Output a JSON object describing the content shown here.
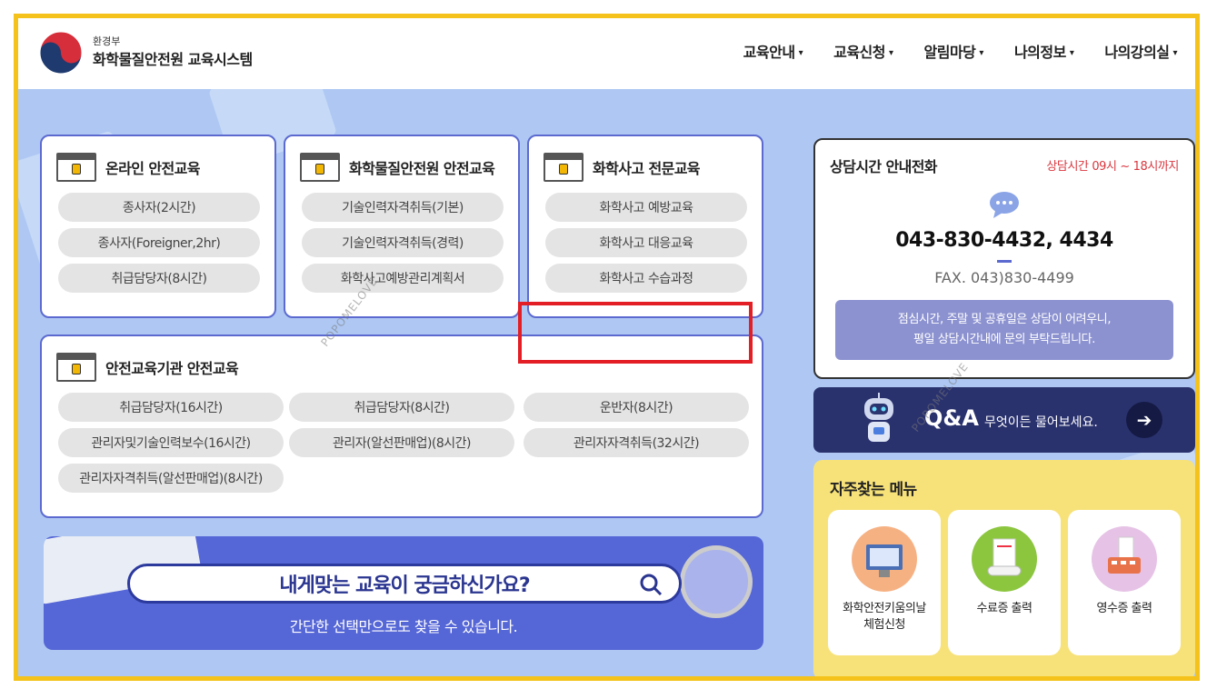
{
  "header": {
    "ministry": "환경부",
    "brand": "화학물질안전원 교육시스템",
    "nav": [
      {
        "label": "교육안내"
      },
      {
        "label": "교육신청"
      },
      {
        "label": "알림마당"
      },
      {
        "label": "나의정보"
      },
      {
        "label": "나의강의실"
      }
    ]
  },
  "cards": {
    "online": {
      "title": "온라인 안전교육",
      "items": [
        "종사자(2시간)",
        "종사자(Foreigner,2hr)",
        "취급담당자(8시간)"
      ]
    },
    "institute": {
      "title": "화학물질안전원 안전교육",
      "items": [
        "기술인력자격취득(기본)",
        "기술인력자격취득(경력)",
        "화학사고예방관리계획서"
      ]
    },
    "accident": {
      "title": "화학사고 전문교육",
      "items": [
        "화학사고 예방교육",
        "화학사고 대응교육",
        "화학사고 수습과정"
      ]
    },
    "agency": {
      "title": "안전교육기관 안전교육",
      "items": [
        "취급담당자(16시간)",
        "취급담당자(8시간)",
        "운반자(8시간)",
        "관리자및기술인력보수(16시간)",
        "관리자(알선판매업)(8시간)",
        "관리자자격취득(32시간)",
        "관리자자격취득(알선판매업)(8시간)"
      ]
    }
  },
  "banner": {
    "search_text": "내게맞는 교육이 궁금하신가요?",
    "sub_text": "간단한 선택만으로도 찾을 수 있습니다."
  },
  "contact": {
    "title": "상담시간 안내전화",
    "hours": "상담시간 09시 ~ 18시까지",
    "phone": "043-830-4432, 4434",
    "fax": "FAX. 043)830-4499",
    "note_line1": "점심시간, 주말 및 공휴일은 상담이 어려우니,",
    "note_line2": "평일 상담시간내에 문의 부탁드립니다."
  },
  "qna": {
    "title": "Q&A",
    "desc": "무엇이든 물어보세요.",
    "arrow": "➔"
  },
  "faq": {
    "title": "자주찾는 메뉴",
    "items": [
      {
        "line1": "화학안전키움의날",
        "line2": "체험신청"
      },
      {
        "line1": "수료증 출력",
        "line2": ""
      },
      {
        "line1": "영수증 출력",
        "line2": ""
      }
    ]
  },
  "watermark": "POPOMELOVE",
  "colors": {
    "frame": "#f4c21a",
    "card_border": "#5c6ad0",
    "highlight": "#e31e24",
    "hours": "#d9363e"
  }
}
